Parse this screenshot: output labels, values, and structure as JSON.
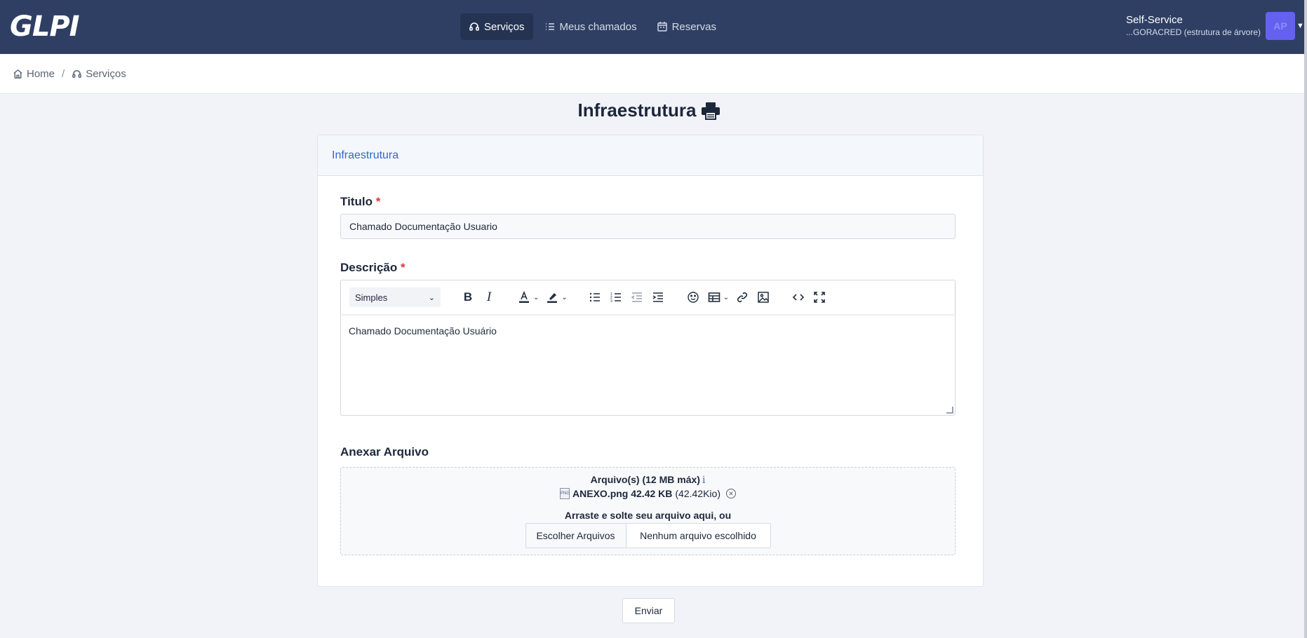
{
  "app": {
    "logo": "GLPI"
  },
  "nav": {
    "items": [
      {
        "label": "Serviços",
        "icon": "headset-icon",
        "active": true
      },
      {
        "label": "Meus chamados",
        "icon": "list-icon",
        "active": false
      },
      {
        "label": "Reservas",
        "icon": "calendar-icon",
        "active": false
      }
    ]
  },
  "user": {
    "profile": "Self-Service",
    "entity": "...GORACRED (estrutura de árvore)",
    "initials": "AP"
  },
  "breadcrumb": [
    {
      "label": "Home",
      "icon": "home-icon"
    },
    {
      "label": "Serviços",
      "icon": "headset-icon"
    }
  ],
  "page": {
    "title": "Infraestrutura",
    "title_icon": "printer-icon"
  },
  "form": {
    "section_header": "Infraestrutura",
    "title_label": "Titulo",
    "title_value": "Chamado Documentação Usuario",
    "description_label": "Descrição",
    "required_mark": "*",
    "editor": {
      "format_select": "Simples",
      "content": "Chamado Documentação Usuário"
    },
    "attach_label": "Anexar Arquivo",
    "dropzone": {
      "max_text": "Arquivo(s) (12 MB máx)",
      "info": "i",
      "file_name": "ANEXO.png 42.42 KB",
      "file_size_kio": "(42.42Kio)",
      "drop_text": "Arraste e solte seu arquivo aqui, ou",
      "choose_button": "Escolher Arquivos",
      "no_file": "Nenhum arquivo escolhido"
    },
    "submit": "Enviar"
  },
  "colors": {
    "navbar": "#2f3f64",
    "accent": "#2f6ac4",
    "avatar": "#6461f0",
    "required": "#d63939"
  }
}
